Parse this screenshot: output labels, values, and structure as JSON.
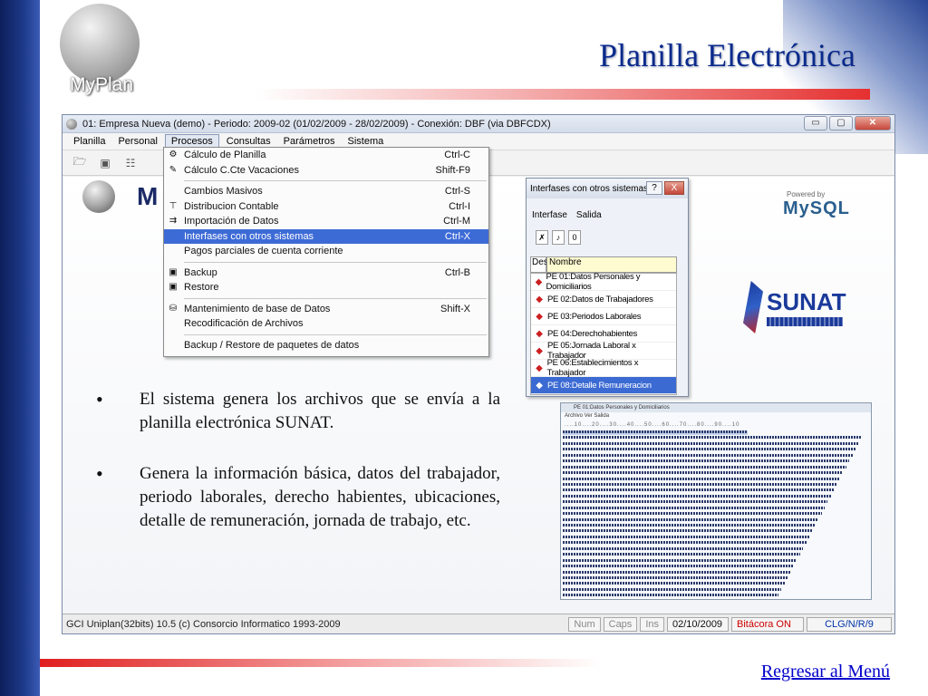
{
  "slide": {
    "title": "Planilla Electrónica",
    "logo_text": "MyPlan",
    "return_link": "Regresar al Menú",
    "bullets": [
      "El sistema genera los archivos que se envía a  la planilla electrónica SUNAT.",
      "Genera la información básica, datos del trabajador, periodo laborales, derecho habientes, ubicaciones, detalle de remuneración, jornada de trabajo, etc."
    ]
  },
  "window": {
    "title": "01: Empresa Nueva  (demo)  - Periodo: 2009-02 (01/02/2009 - 28/02/2009) - Conexión: DBF (via DBFCDX)",
    "controls": {
      "minimize": "▭",
      "maximize": "▢",
      "close": "✕"
    },
    "menu": [
      "Planilla",
      "Personal",
      "Procesos",
      "Consultas",
      "Parámetros",
      "Sistema"
    ],
    "active_menu_index": 2,
    "toolbar": [
      "folder-open-icon",
      "window-icon",
      "grid-icon"
    ],
    "inner_logo_text": "M",
    "status": {
      "main": "GCI Uniplan(32bits) 10.5  (c) Consorcio Informatico 1993-2009",
      "num": "Num",
      "caps": "Caps",
      "ins": "Ins",
      "date": "02/10/2009",
      "bitacora": "Bitácora ON",
      "clg": "CLG/N/R/9"
    }
  },
  "dropdown": {
    "groups": [
      [
        {
          "label": "Cálculo de Planilla",
          "shortcut": "Ctrl-C",
          "icon": "calculator-icon",
          "glyph": "⚙"
        },
        {
          "label": "Cálculo C.Cte Vacaciones",
          "shortcut": "Shift-F9",
          "icon": "vacation-icon",
          "glyph": "✎"
        }
      ],
      [
        {
          "label": "Cambios Masivos",
          "shortcut": "Ctrl-S",
          "icon": "",
          "glyph": ""
        },
        {
          "label": "Distribucion Contable",
          "shortcut": "Ctrl-I",
          "icon": "distribution-icon",
          "glyph": "⊤"
        },
        {
          "label": "Importación de Datos",
          "shortcut": "Ctrl-M",
          "icon": "import-icon",
          "glyph": "⇉"
        },
        {
          "label": "Interfases con otros sistemas",
          "shortcut": "Ctrl-X",
          "icon": "",
          "glyph": "",
          "highlighted": true
        },
        {
          "label": "Pagos parciales de cuenta corriente",
          "shortcut": "",
          "icon": "",
          "glyph": ""
        }
      ],
      [
        {
          "label": "Backup",
          "shortcut": "Ctrl-B",
          "icon": "save-icon",
          "glyph": "▣"
        },
        {
          "label": "Restore",
          "shortcut": "",
          "icon": "restore-icon",
          "glyph": "▣"
        }
      ],
      [
        {
          "label": "Mantenimiento de base de Datos",
          "shortcut": "Shift-X",
          "icon": "database-icon",
          "glyph": "⛁"
        },
        {
          "label": "Recodificación de Archivos",
          "shortcut": "",
          "icon": "",
          "glyph": ""
        }
      ],
      [
        {
          "label": "Backup / Restore de paquetes de datos",
          "shortcut": "",
          "icon": "",
          "glyph": ""
        }
      ]
    ]
  },
  "interfaces_dialog": {
    "title": "Interfases con otros sistemas",
    "help": "?",
    "close": "X",
    "menu": [
      "Interfase",
      "Salida"
    ],
    "tools": [
      "✗",
      "♪",
      "0"
    ],
    "header_dest": "Dest",
    "header_name": "Nombre",
    "rows": [
      "PE 01:Datos Personales y Domiciliarios",
      "PE 02:Datos de Trabajadores",
      "PE 03:Periodos Laborales",
      "PE 04:Derechohabientes",
      "PE 05:Jornada Laboral x Trabajador",
      "PE 06:Establecimientos x Trabajador",
      "PE 08:Detalle Remuneracion"
    ],
    "selected_index": 6,
    "row_glyph": "◆"
  },
  "data_window": {
    "title": "PE 01:Datos Personales y Domiciliarios",
    "menu": "Archivo   Ver   Salida",
    "ruler": "....10....20....30....40....50....60....70....80....90....10"
  },
  "brand": {
    "powered_by": "Powered by",
    "mysql_a": "MySQL",
    "mysql_b": "",
    "sunat": "SUNAT",
    "colors": {
      "title": "#0a2a8c",
      "highlight": "#3d6bd6",
      "accent_red": "#e53030"
    }
  }
}
